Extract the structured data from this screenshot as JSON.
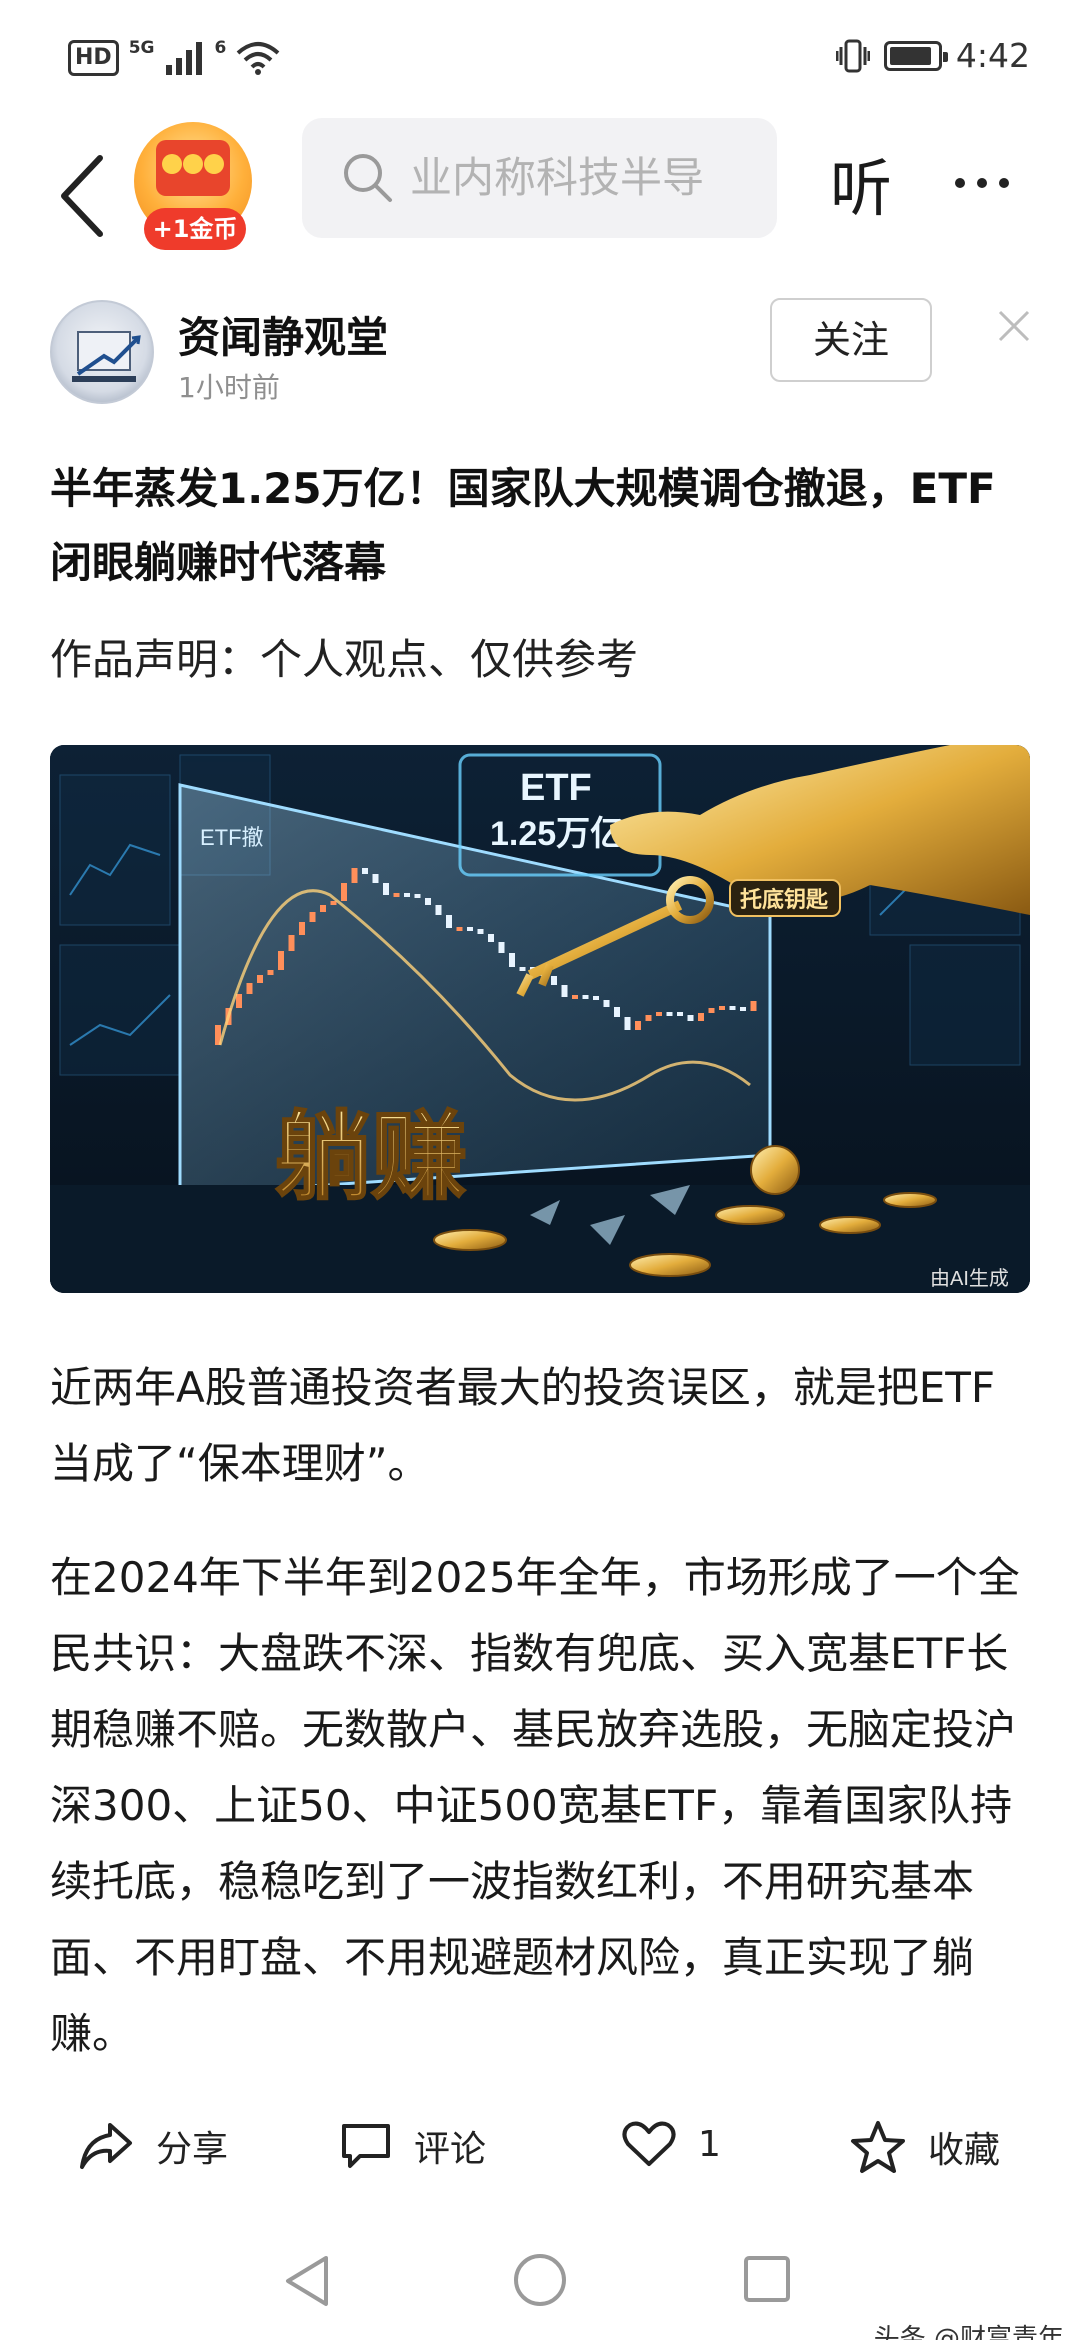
{
  "status_bar": {
    "network_hd": "HD",
    "signal_label": "5G",
    "wifi_label": "6",
    "time": "4:42",
    "battery_level": 0.9
  },
  "nav": {
    "coin_reward": "+1金币",
    "search_placeholder": "业内称科技半导",
    "listen_label": "听"
  },
  "author": {
    "name": "资闻静观堂",
    "time": "1小时前",
    "follow_label": "关注"
  },
  "article": {
    "title": "半年蒸发1.25万亿！国家队大规模调仓撤退，ETF闭眼躺赚时代落幕",
    "declaration": "作品声明：个人观点、仅供参考",
    "hero_image": {
      "etf_label": "ETF",
      "etf_amount": "1.25万亿",
      "chart_label": "ETF撤",
      "key_tag": "托底钥匙",
      "big_text": "躺赚",
      "ai_note": "由AI生成"
    },
    "paragraphs": [
      "近两年A股普通投资者最大的投资误区，就是把ETF当成了“保本理财”。",
      "在2024年下半年到2025年全年，市场形成了一个全民共识：大盘跌不深、指数有兜底、买入宽基ETF长期稳赚不赔。无数散户、基民放弃选股，无脑定投沪深300、上证50、中证500宽基ETF，靠着国家队持续托底，稳稳吃到了一波指数红利，不用研究基本面、不用盯盘、不用规避题材风险，真正实现了躺赚。"
    ]
  },
  "actions": {
    "share": "分享",
    "comment": "评论",
    "like_count": "1",
    "collect": "收藏"
  },
  "watermark": "头条 @财富青年",
  "colors": {
    "accent_red": "#ef3b2b",
    "coin_gold": "#ffb03b",
    "text_primary": "#1a1a1a",
    "text_secondary": "#8f8f8f"
  },
  "icons": [
    "back-arrow-icon",
    "search-icon",
    "more-icon",
    "close-icon",
    "share-icon",
    "comment-icon",
    "heart-icon",
    "star-icon",
    "nav-back-icon",
    "nav-home-icon",
    "nav-recents-icon"
  ]
}
